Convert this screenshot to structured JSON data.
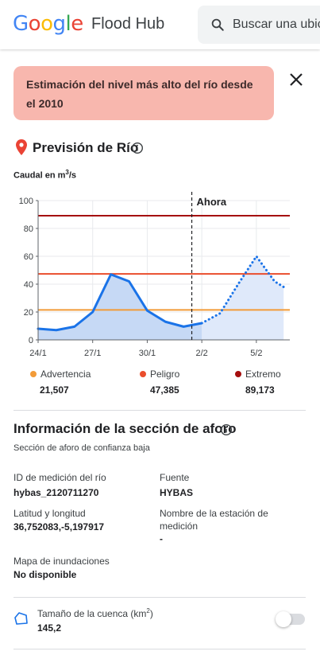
{
  "header": {
    "logo_letters": [
      {
        "ch": "G",
        "color": "#4285F4"
      },
      {
        "ch": "o",
        "color": "#EA4335"
      },
      {
        "ch": "o",
        "color": "#FBBC05"
      },
      {
        "ch": "g",
        "color": "#4285F4"
      },
      {
        "ch": "l",
        "color": "#34A853"
      },
      {
        "ch": "e",
        "color": "#EA4335"
      }
    ],
    "app_title": "Flood Hub",
    "search_text": "Buscar una ubic",
    "search_icon": "search-icon"
  },
  "banner": {
    "text": "Estimación del nivel más alto del río desde el 2010",
    "bg_color": "#f8b7ae"
  },
  "forecast": {
    "title": "Previsión de Río",
    "units_prefix": "Caudal en m",
    "units_sup": "3",
    "units_suffix": "/s"
  },
  "chart_data": {
    "type": "line",
    "x_ticks": [
      "24/1",
      "27/1",
      "30/1",
      "2/2",
      "5/2"
    ],
    "y_ticks": [
      "100",
      "80",
      "60",
      "40",
      "20",
      "0"
    ],
    "ylim": [
      0,
      100
    ],
    "now_label": "Ahora",
    "now_x": "1/2",
    "series": [
      {
        "style": "solid-filled",
        "color": "#1a73e8",
        "points": [
          {
            "x": "24/1",
            "y": 8
          },
          {
            "x": "25/1",
            "y": 7
          },
          {
            "x": "26/1",
            "y": 9.5
          },
          {
            "x": "27/1",
            "y": 20
          },
          {
            "x": "28/1",
            "y": 47
          },
          {
            "x": "29/1",
            "y": 42
          },
          {
            "x": "30/1",
            "y": 21
          },
          {
            "x": "31/1",
            "y": 13
          },
          {
            "x": "1/2",
            "y": 9.5
          },
          {
            "x": "2/2",
            "y": 12
          }
        ]
      },
      {
        "style": "dotted-filled",
        "color": "#1a73e8",
        "points": [
          {
            "x": "2/2",
            "y": 12
          },
          {
            "x": "3/2",
            "y": 19
          },
          {
            "x": "4/2",
            "y": 40
          },
          {
            "x": "5/2",
            "y": 60
          },
          {
            "x": "6/2",
            "y": 42
          },
          {
            "x": "6.5/2",
            "y": 38
          }
        ]
      }
    ],
    "thresholds": [
      {
        "name": "Advertencia",
        "value": 21.507,
        "display": "21,507",
        "color": "#f29b38"
      },
      {
        "name": "Peligro",
        "value": 47.385,
        "display": "47,385",
        "color": "#ea4d2c"
      },
      {
        "name": "Extremo",
        "value": 89.173,
        "display": "89,173",
        "color": "#a50e0e"
      }
    ]
  },
  "gauge_section": {
    "title": "Información de la sección de aforo",
    "subtitle": "Sección de aforo de confianza baja",
    "fields": {
      "river_id_label": "ID de medición del río",
      "river_id_value": "hybas_2120711270",
      "source_label": "Fuente",
      "source_value": "HYBAS",
      "latlng_label": "Latitud y longitud",
      "latlng_value": "36,752083,-5,197917",
      "station_label": "Nombre de la estación de medición",
      "station_value": "-",
      "map_label": "Mapa de inundaciones",
      "map_value": "No disponible"
    },
    "basin": {
      "label_prefix": "Tamaño de la cuenca (km",
      "label_sup": "2",
      "label_suffix": ")",
      "value": "145,2",
      "toggle_on": false
    }
  }
}
